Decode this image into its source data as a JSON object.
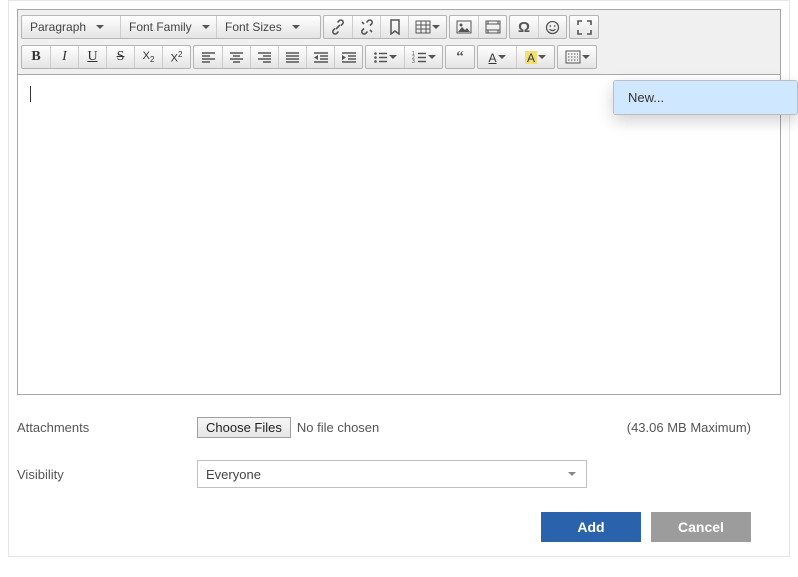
{
  "toolbar": {
    "paragraph": "Paragraph",
    "font_family": "Font Family",
    "font_sizes": "Font Sizes"
  },
  "popup": {
    "new_item": "New..."
  },
  "form": {
    "attachments_label": "Attachments",
    "choose_files": "Choose Files",
    "no_file": "No file chosen",
    "max_size": "(43.06 MB Maximum)",
    "visibility_label": "Visibility",
    "visibility_value": "Everyone"
  },
  "buttons": {
    "add": "Add",
    "cancel": "Cancel"
  }
}
